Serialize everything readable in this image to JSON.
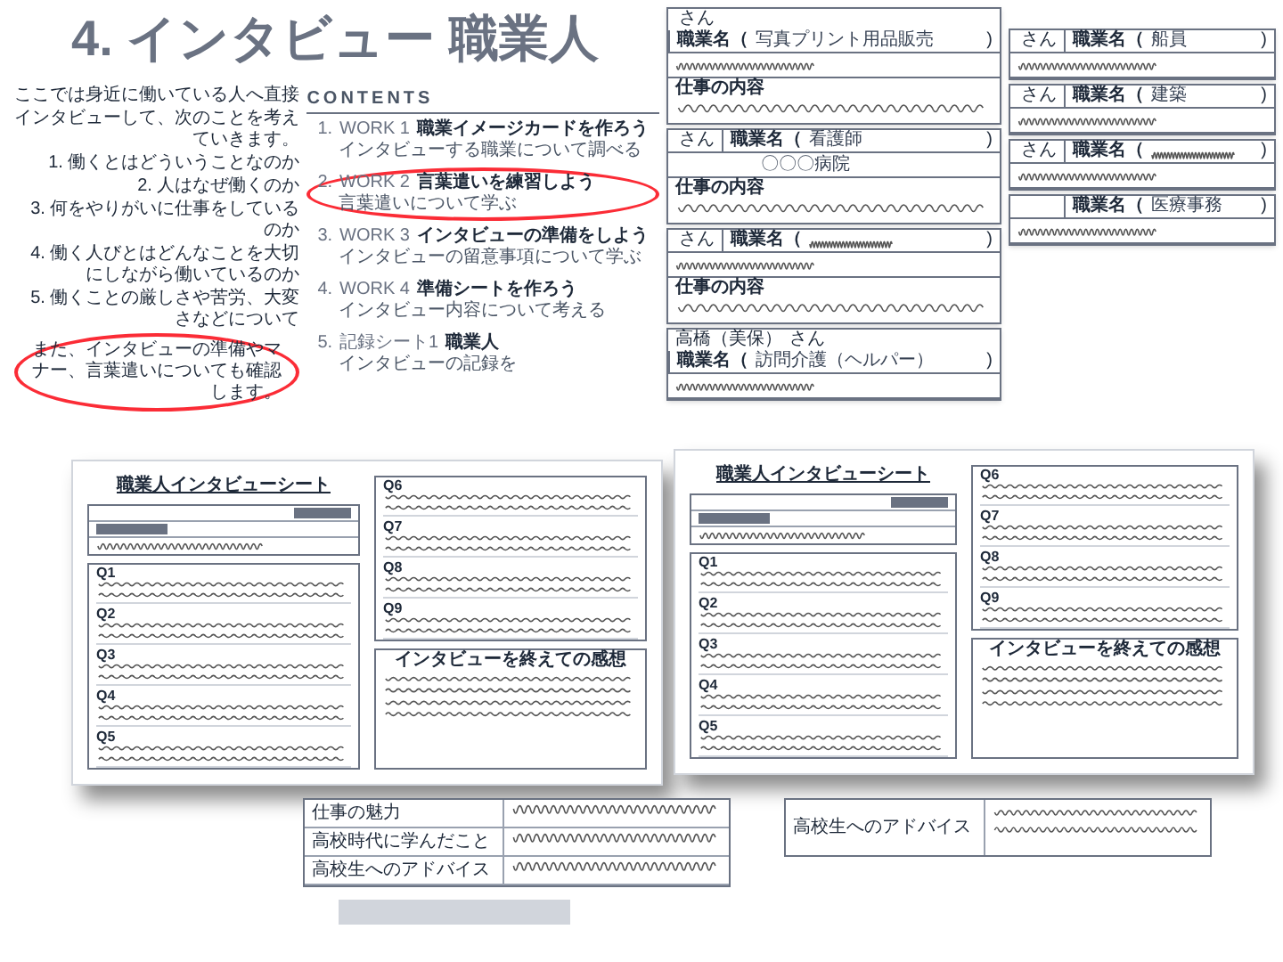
{
  "title": "4. インタビュー 職業人",
  "intro": {
    "lines": [
      "ここでは身近に働いている人へ直接",
      "インタビューして、次のことを考えていきます。",
      "1. 働くとはどういうことなのか",
      "2. 人はなぜ働くのか",
      "3. 何をやりがいに仕事をしているのか",
      "4. 働く人びとはどんなことを大切にしながら働いているのか",
      "5. 働くことの厳しさや苦労、大変さなどについて"
    ],
    "note": {
      "text": "また、インタビューの準備やマナー、言葉遣いについても確認します。",
      "circled": true
    }
  },
  "contents": {
    "heading": "CONTENTS",
    "items": [
      {
        "number": "1.",
        "label": "WORK 1",
        "title": "職業イメージカードを作ろう",
        "subtitle": "インタビューする職業について調べる",
        "circled": false
      },
      {
        "number": "2.",
        "label": "WORK 2",
        "title": "言葉遣いを練習しよう",
        "subtitle": "言葉遣いについて学ぶ",
        "circled": true
      },
      {
        "number": "3.",
        "label": "WORK 3",
        "title": "インタビューの準備をしよう",
        "subtitle": "インタビューの留意事項について学ぶ",
        "circled": false
      },
      {
        "number": "4.",
        "label": "WORK 4",
        "title": "準備シートを作ろう",
        "subtitle": "インタビュー内容について考える",
        "circled": false
      },
      {
        "number": "5.",
        "label": "記録シート1",
        "title": "職業人",
        "subtitle": "インタビューの記録を",
        "circled": false
      }
    ]
  },
  "forms_left": [
    {
      "suffix": "さん",
      "job_label": "職業名（",
      "job": "写真プリント用品販売",
      "job_close": ")",
      "content_label": "仕事の内容"
    },
    {
      "suffix": "さん",
      "job_label": "職業名（",
      "job": "看護師",
      "job_close": ")",
      "workplace": "〇〇〇病院",
      "content_label": "仕事の内容"
    },
    {
      "suffix": "さん",
      "job_label": "職業名（",
      "job_close": ")",
      "content_label": "仕事の内容"
    },
    {
      "name": "高橋（美保）",
      "suffix": "さん",
      "job_label": "職業名（",
      "job": "訪問介護（ヘルパー）",
      "job_close": ")"
    }
  ],
  "forms_right": [
    {
      "suffix": "さん",
      "job_label": "職業名（",
      "job": "船員",
      "job_close": ")"
    },
    {
      "suffix": "さん",
      "job_label": "職業名（",
      "job": "建築",
      "job_close": ")"
    },
    {
      "suffix": "さん",
      "job_label": "職業名（",
      "job_close": ")"
    },
    {
      "job_label": "職業名（",
      "job": "医療事務",
      "job_close": ")"
    }
  ],
  "spreads": [
    {
      "title": "職業人インタビューシート",
      "left_questions": [
        "Q1",
        "Q2",
        "Q3",
        "Q4",
        "Q5"
      ],
      "right_questions": [
        "Q6",
        "Q7",
        "Q8",
        "Q9"
      ],
      "impressions_title": "インタビューを終えての感想"
    },
    {
      "title": "職業人インタビューシート",
      "left_questions": [
        "Q1",
        "Q2",
        "Q3",
        "Q4",
        "Q5"
      ],
      "right_questions": [
        "Q6",
        "Q7",
        "Q8",
        "Q9"
      ],
      "impressions_title": "インタビューを終えての感想"
    }
  ],
  "bottom_table": {
    "rows": [
      {
        "label": "仕事の魅力"
      },
      {
        "label": "高校時代に学んだこと"
      },
      {
        "label": "高校生へのアドバイス"
      }
    ]
  },
  "bottom_right": {
    "label": "高校生へのアドバイス"
  }
}
